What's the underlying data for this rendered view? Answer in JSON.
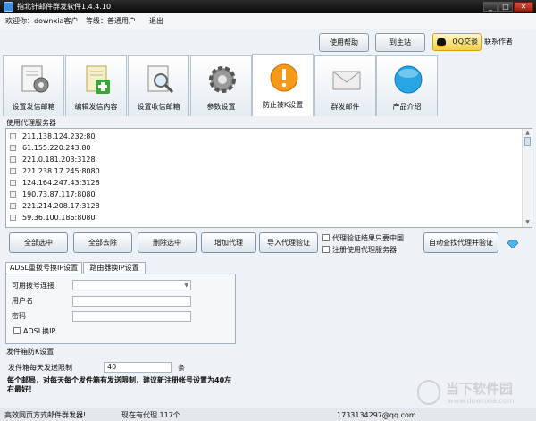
{
  "window": {
    "title": "指北针邮件群发软件1.4.4.10",
    "min": "_",
    "max": "□",
    "close": "✕"
  },
  "infobar": {
    "welcome": "欢迎你：downxia客户",
    "level": "等级：普通用户",
    "logout": "退出"
  },
  "topbuttons": {
    "help": "使用帮助",
    "home": "到主站",
    "qq": "QQ交谈",
    "contact": "联系作者"
  },
  "tabs": [
    {
      "label": "设置发信邮箱",
      "icon": "gear-mailbox-icon"
    },
    {
      "label": "编辑发信内容",
      "icon": "document-add-icon"
    },
    {
      "label": "设置收信邮箱",
      "icon": "magnify-document-icon"
    },
    {
      "label": "参数设置",
      "icon": "gear-icon"
    },
    {
      "label": "防止被K设置",
      "icon": "warning-icon"
    },
    {
      "label": "群发邮件",
      "icon": "envelope-icon"
    },
    {
      "label": "产品介绍",
      "icon": "new-badge-icon"
    }
  ],
  "proxy": {
    "section_label": "使用代理服务器",
    "items": [
      "211.138.124.232:80",
      "61.155.220.243:80",
      "221.0.181.203:3128",
      "221.238.17.245:8080",
      "124.164.247.43:3128",
      "190.73.87.117:8080",
      "221.214.208.17:3128",
      "59.36.100.186:8080"
    ]
  },
  "actions": {
    "select_all": "全部选中",
    "clear_all": "全部去除",
    "delete_selected": "删除选中",
    "add_proxy": "增加代理",
    "import_proxy": "导入代理验证",
    "verify_china_only": "代理验证结果只要中国",
    "register_use_proxy": "注册使用代理服务器",
    "auto_find": "自动查找代理并验证"
  },
  "subtabs": {
    "adsl": "ADSL重拨号换IP设置",
    "router": "路由器换IP设置"
  },
  "adsl": {
    "connection_label": "可用拨号连接",
    "connection_value": "",
    "username_label": "用户名",
    "username_value": "",
    "password_label": "密码",
    "password_value": "",
    "adsl_switch": "ADSL换IP"
  },
  "anti_k": {
    "group_label": "发件箱防K设置",
    "daily_limit_label": "发件箱每天发送限制",
    "daily_limit_value": "40",
    "unit": "条",
    "note": "每个邮局，对每天每个发件箱有发送限制，建议新注册帐号设置为40左右最好！"
  },
  "status": {
    "left": "高效网页方式邮件群发器!",
    "proxy_count": "现在有代理 117个",
    "email": "1733134297@qq.com"
  },
  "watermark": {
    "text": "当下软件园",
    "url": "www.downxia.com"
  }
}
